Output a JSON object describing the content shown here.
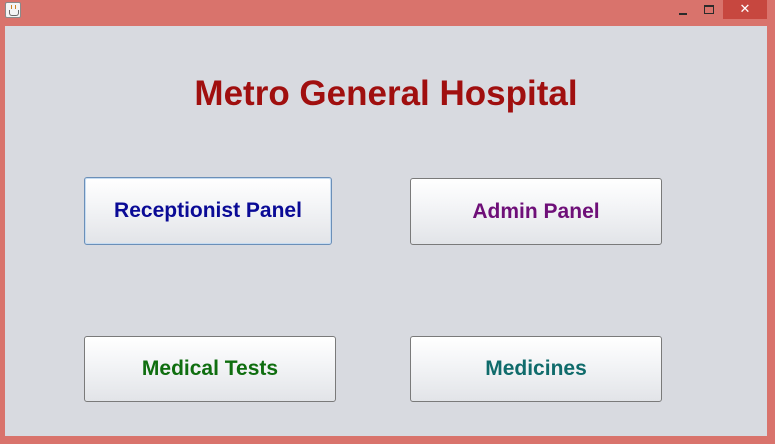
{
  "window": {
    "minimize_symbol": "",
    "close_symbol": "✕",
    "icon": "java-app-icon"
  },
  "main": {
    "title": "Metro General Hospital",
    "buttons": [
      {
        "label": "Receptionist Panel",
        "color": "#0a0a96",
        "focused": true
      },
      {
        "label": "Admin Panel",
        "color": "#6e0f78",
        "focused": false
      },
      {
        "label": "Medical Tests",
        "color": "#0f6e0f",
        "focused": false
      },
      {
        "label": "Medicines",
        "color": "#0f6b6b",
        "focused": false
      }
    ]
  },
  "colors": {
    "title_bar": "#d9736c",
    "close_button": "#c7473f",
    "content_background": "#d8dae0",
    "title_text": "#a00f0f"
  }
}
